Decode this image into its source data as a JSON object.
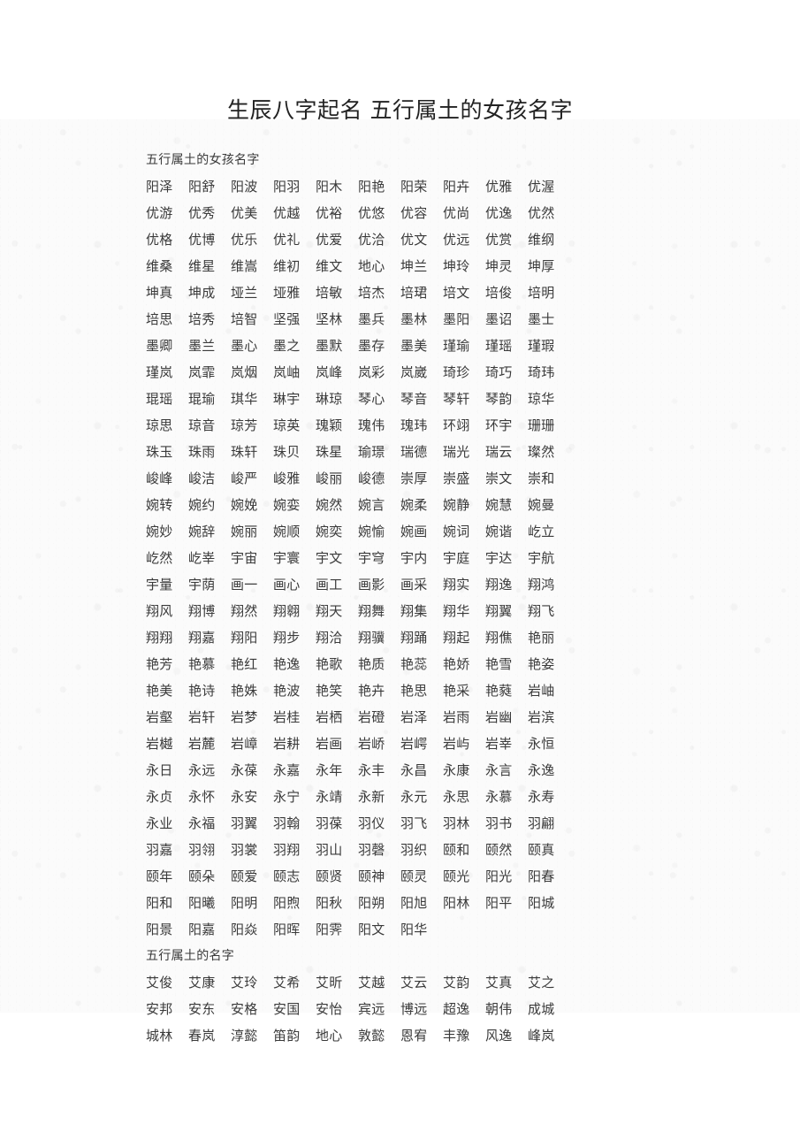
{
  "document": {
    "title": "生辰八字起名 五行属土的女孩名字",
    "sections": [
      {
        "heading": "五行属土的女孩名字",
        "columns": 10,
        "names": [
          "阳泽",
          "阳舒",
          "阳波",
          "阳羽",
          "阳木",
          "阳艳",
          "阳荣",
          "阳卉",
          "优雅",
          "优渥",
          "优游",
          "优秀",
          "优美",
          "优越",
          "优裕",
          "优悠",
          "优容",
          "优尚",
          "优逸",
          "优然",
          "优格",
          "优博",
          "优乐",
          "优礼",
          "优爱",
          "优洽",
          "优文",
          "优远",
          "优赏",
          "维纲",
          "维桑",
          "维星",
          "维嵩",
          "维初",
          "维文",
          "地心",
          "坤兰",
          "坤玲",
          "坤灵",
          "坤厚",
          "坤真",
          "坤成",
          "垭兰",
          "垭雅",
          "培敏",
          "培杰",
          "培珺",
          "培文",
          "培俊",
          "培明",
          "培思",
          "培秀",
          "培智",
          "坚强",
          "坚林",
          "墨兵",
          "墨林",
          "墨阳",
          "墨诏",
          "墨士",
          "墨卿",
          "墨兰",
          "墨心",
          "墨之",
          "墨默",
          "墨存",
          "墨美",
          "瑾瑜",
          "瑾瑶",
          "瑾瑕",
          "瑾岚",
          "岚霏",
          "岚烟",
          "岚岫",
          "岚峰",
          "岚彩",
          "岚崴",
          "琦珍",
          "琦巧",
          "琦玮",
          "琨瑶",
          "琨瑜",
          "琪华",
          "琳宇",
          "琳琼",
          "琴心",
          "琴音",
          "琴轩",
          "琴韵",
          "琼华",
          "琼思",
          "琼音",
          "琼芳",
          "琼英",
          "瑰颖",
          "瑰伟",
          "瑰玮",
          "环翊",
          "环宇",
          "珊珊",
          "珠玉",
          "珠雨",
          "珠轩",
          "珠贝",
          "珠星",
          "瑜璟",
          "瑞德",
          "瑞光",
          "瑞云",
          "璨然",
          "峻峰",
          "峻洁",
          "峻严",
          "峻雅",
          "峻丽",
          "峻德",
          "崇厚",
          "崇盛",
          "崇文",
          "崇和",
          "婉转",
          "婉约",
          "婉娩",
          "婉娈",
          "婉然",
          "婉言",
          "婉柔",
          "婉静",
          "婉慧",
          "婉曼",
          "婉妙",
          "婉辞",
          "婉丽",
          "婉顺",
          "婉奕",
          "婉愉",
          "婉画",
          "婉词",
          "婉谐",
          "屹立",
          "屹然",
          "屹峷",
          "宇宙",
          "宇寰",
          "宇文",
          "宇穹",
          "宇内",
          "宇庭",
          "宇达",
          "宇航",
          "宇量",
          "宇荫",
          "画一",
          "画心",
          "画工",
          "画影",
          "画采",
          "翔实",
          "翔逸",
          "翔鸿",
          "翔风",
          "翔博",
          "翔然",
          "翔翱",
          "翔天",
          "翔舞",
          "翔集",
          "翔华",
          "翔翼",
          "翔飞",
          "翔翔",
          "翔嘉",
          "翔阳",
          "翔步",
          "翔洽",
          "翔骥",
          "翔踊",
          "翔起",
          "翔僬",
          "艳丽",
          "艳芳",
          "艳慕",
          "艳红",
          "艳逸",
          "艳歌",
          "艳质",
          "艳蕊",
          "艳娇",
          "艳雪",
          "艳姿",
          "艳美",
          "艳诗",
          "艳姝",
          "艳波",
          "艳笑",
          "艳卉",
          "艳思",
          "艳采",
          "艳蕤",
          "岩岫",
          "岩壑",
          "岩轩",
          "岩梦",
          "岩桂",
          "岩栖",
          "岩磴",
          "岩泽",
          "岩雨",
          "岩幽",
          "岩滨",
          "岩樾",
          "岩麓",
          "岩嶂",
          "岩耕",
          "岩画",
          "岩峤",
          "岩崿",
          "岩屿",
          "岩峷",
          "永恒",
          "永日",
          "永远",
          "永葆",
          "永嘉",
          "永年",
          "永丰",
          "永昌",
          "永康",
          "永言",
          "永逸",
          "永贞",
          "永怀",
          "永安",
          "永宁",
          "永靖",
          "永新",
          "永元",
          "永思",
          "永慕",
          "永寿",
          "永业",
          "永福",
          "羽翼",
          "羽翰",
          "羽葆",
          "羽仪",
          "羽飞",
          "羽林",
          "羽书",
          "羽翩",
          "羽嘉",
          "羽翎",
          "羽裳",
          "羽翔",
          "羽山",
          "羽磬",
          "羽织",
          "颐和",
          "颐然",
          "颐真",
          "颐年",
          "颐朵",
          "颐爱",
          "颐志",
          "颐贤",
          "颐神",
          "颐灵",
          "颐光",
          "阳光",
          "阳春",
          "阳和",
          "阳曦",
          "阳明",
          "阳煦",
          "阳秋",
          "阳朔",
          "阳旭",
          "阳林",
          "阳平",
          "阳城",
          "阳景",
          "阳嘉",
          "阳焱",
          "阳晖",
          "阳霁",
          "阳文",
          "阳华"
        ]
      },
      {
        "heading": "五行属土的名字",
        "columns": 10,
        "names": [
          "艾俊",
          "艾康",
          "艾玲",
          "艾希",
          "艾昕",
          "艾越",
          "艾云",
          "艾韵",
          "艾真",
          "艾之",
          "安邦",
          "安东",
          "安格",
          "安国",
          "安怡",
          "宾远",
          "博远",
          "超逸",
          "朝伟",
          "成城",
          "城林",
          "春岚",
          "淳懿",
          "笛韵",
          "地心",
          "敦懿",
          "恩宥",
          "丰豫",
          "风逸",
          "峰岚"
        ]
      }
    ]
  },
  "colors": {
    "page_background": "#ffffff",
    "paper_texture": "#fbfbfb",
    "title_text": "#222222",
    "body_text": "#3a3a3a"
  }
}
